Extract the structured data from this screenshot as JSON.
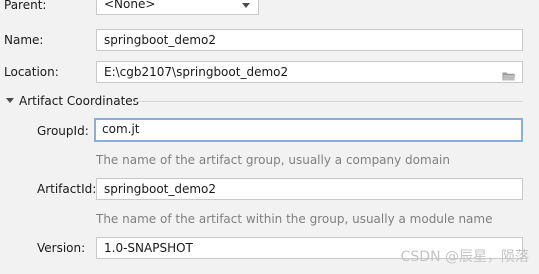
{
  "parent": {
    "label": "Parent:",
    "value": "<None>"
  },
  "name": {
    "label": "Name:",
    "value": "springboot_demo2"
  },
  "location": {
    "label": "Location:",
    "value": "E:\\cgb2107\\springboot_demo2",
    "icon": "folder-icon"
  },
  "artifact_section": {
    "title": "Artifact Coordinates",
    "group_id": {
      "label": "GroupId:",
      "value": "com.jt",
      "hint": "The name of the artifact group, usually a company domain"
    },
    "artifact_id": {
      "label": "ArtifactId:",
      "value": "springboot_demo2",
      "hint": "The name of the artifact within the group, usually a module name"
    },
    "version": {
      "label": "Version:",
      "value": "1.0-SNAPSHOT"
    }
  },
  "watermark": "CSDN @辰星，陨落",
  "colors": {
    "background": "#f2f2f2",
    "focus_border": "#87afda",
    "hint_text": "#7f7f7f"
  }
}
